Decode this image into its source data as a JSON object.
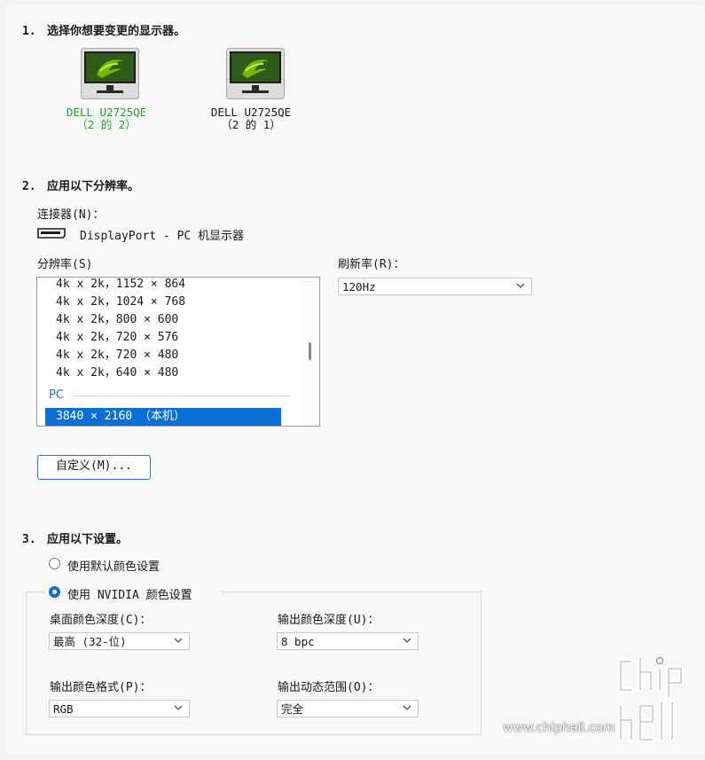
{
  "step1": {
    "num": "1.",
    "title": "选择你想要变更的显示器。"
  },
  "monitors": [
    {
      "name": "DELL U2725QE",
      "index": "（2 的 2）",
      "selected": true
    },
    {
      "name": "DELL U2725QE",
      "index": "（2 的 1）",
      "selected": false
    }
  ],
  "step2": {
    "num": "2.",
    "title": "应用以下分辨率。"
  },
  "connector": {
    "label": "连接器(N)：",
    "value": "DisplayPort - PC 机显示器"
  },
  "resolution": {
    "label": "分辨率(S)",
    "items": [
      "4k x 2k，1152 × 864",
      "4k x 2k，1024 × 768",
      "4k x 2k，800 × 600",
      "4k x 2k，720 × 576",
      "4k x 2k，720 × 480",
      "4k x 2k，640 × 480"
    ],
    "group": "PC",
    "selected": "3840 × 2160 （本机）"
  },
  "refresh": {
    "label": "刷新率(R)：",
    "value": "120Hz"
  },
  "custom_button": "自定义(M)...",
  "step3": {
    "num": "3.",
    "title": "应用以下设置。"
  },
  "color_mode": {
    "default_label": "使用默认颜色设置",
    "nvidia_label": "使用 NVIDIA 颜色设置",
    "selected": "nvidia"
  },
  "desktop_depth": {
    "label": "桌面颜色深度(C)：",
    "value": "最高 (32-位)"
  },
  "output_depth": {
    "label": "输出颜色深度(U)：",
    "value": "8 bpc"
  },
  "output_format": {
    "label": "输出颜色格式(P)：",
    "value": "RGB"
  },
  "dynamic_range": {
    "label": "输出动态范围(O)：",
    "value": "完全"
  },
  "watermark": {
    "logo": "chip hell",
    "url": "www.chiphell.com"
  },
  "colors": {
    "accent": "#0a6fd6",
    "active_monitor": "#2aa02a",
    "nvidia_green": "#76b900"
  }
}
